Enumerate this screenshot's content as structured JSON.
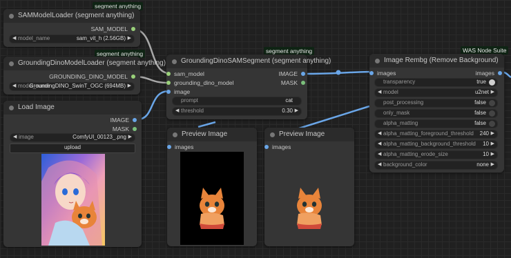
{
  "canvas": {
    "background": "#202020"
  },
  "colors": {
    "model_pin": "#9ad17a",
    "image_pin": "#6aa6e8",
    "mask_pin": "#7bbf7b",
    "link_image": "#6aa6e8",
    "link_model": "#a8a8a8"
  },
  "nodes": {
    "sam_loader": {
      "badge": "segment anything",
      "title": "SAMModelLoader (segment anything)",
      "output": "SAM_MODEL",
      "widget": {
        "label": "model_name",
        "value": "sam_vit_h (2.56GB)"
      }
    },
    "dino_loader": {
      "badge": "segment anything",
      "title": "GroundingDinoModelLoader (segment anything)",
      "output": "GROUNDING_DINO_MODEL",
      "widget": {
        "label": "model_name",
        "value": "GroundingDINO_SwinT_OGC (694MB)"
      }
    },
    "load_image": {
      "title": "Load Image",
      "outputs": [
        "IMAGE",
        "MASK"
      ],
      "widget": {
        "label": "image",
        "value": "ComfyUI_00123_.png"
      },
      "upload_label": "upload"
    },
    "dino_sam": {
      "badge": "segment anything",
      "title": "GroundingDinoSAMSegment (segment anything)",
      "inputs": [
        "sam_model",
        "grounding_dino_model",
        "image"
      ],
      "outputs": [
        "IMAGE",
        "MASK"
      ],
      "prompt": {
        "label": "prompt",
        "value": "cat"
      },
      "threshold": {
        "label": "threshold",
        "value": "0.30"
      }
    },
    "preview1": {
      "title": "Preview Image",
      "input": "images"
    },
    "preview2": {
      "title": "Preview Image",
      "input": "images"
    },
    "rembg": {
      "badge": "WAS Node Suite",
      "title": "Image Rembg (Remove Background)",
      "input": "images",
      "output": "images",
      "widgets": [
        {
          "label": "transparency",
          "value": "true",
          "kind": "toggle",
          "on": true
        },
        {
          "label": "model",
          "value": "u2net",
          "kind": "combo"
        },
        {
          "label": "post_processing",
          "value": "false",
          "kind": "toggle",
          "on": false
        },
        {
          "label": "only_mask",
          "value": "false",
          "kind": "toggle",
          "on": false
        },
        {
          "label": "alpha_matting",
          "value": "false",
          "kind": "toggle",
          "on": false
        },
        {
          "label": "alpha_matting_foreground_threshold",
          "value": "240",
          "kind": "number"
        },
        {
          "label": "alpha_matting_background_threshold",
          "value": "10",
          "kind": "number"
        },
        {
          "label": "alpha_matting_erode_size",
          "value": "10",
          "kind": "number"
        },
        {
          "label": "background_color",
          "value": "none",
          "kind": "combo"
        }
      ]
    }
  }
}
